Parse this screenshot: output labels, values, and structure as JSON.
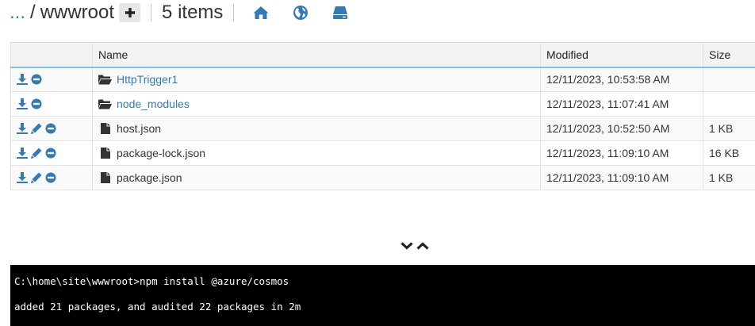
{
  "header": {
    "breadcrumb_ellipsis": "...",
    "separator": "/",
    "folder": "wwwroot",
    "item_count": "5 items",
    "icons": [
      "plus-icon",
      "home-icon",
      "globe-icon",
      "drive-icon"
    ]
  },
  "table": {
    "columns": {
      "name": "Name",
      "modified": "Modified",
      "size": "Size"
    },
    "rows": [
      {
        "name": "HttpTrigger1",
        "type": "folder",
        "modified": "12/11/2023, 10:53:58 AM",
        "size": ""
      },
      {
        "name": "node_modules",
        "type": "folder",
        "modified": "12/11/2023, 11:07:41 AM",
        "size": ""
      },
      {
        "name": "host.json",
        "type": "file",
        "modified": "12/11/2023, 10:52:50 AM",
        "size": "1 KB"
      },
      {
        "name": "package-lock.json",
        "type": "file",
        "modified": "12/11/2023, 11:09:10 AM",
        "size": "16 KB"
      },
      {
        "name": "package.json",
        "type": "file",
        "modified": "12/11/2023, 11:09:10 AM",
        "size": "1 KB"
      }
    ]
  },
  "console": {
    "command": "C:\\home\\site\\wwwroot>npm install @azure/cosmos",
    "output": "added 21 packages, and audited 22 packages in 2m"
  },
  "colors": {
    "accent": "#337ab7",
    "header_border": "#7fc0e4",
    "console_bg": "#000000"
  }
}
